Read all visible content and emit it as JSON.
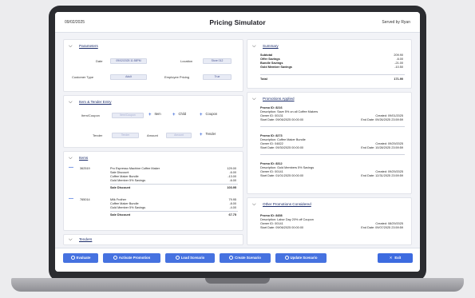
{
  "header": {
    "date": "09/02/2025",
    "title": "Pricing Simulator",
    "user": "Served by Ryan"
  },
  "parameters": {
    "title": "Parameters",
    "date_label": "Date",
    "date_value": "09/02/2025 11:58PM",
    "location_label": "Location",
    "location_value": "Store 012",
    "customer_type_label": "Customer Type",
    "customer_type_value": "Adult",
    "employee_pricing_label": "Employee Pricing",
    "employee_pricing_value": "True"
  },
  "items_tender": {
    "title": "Item & Tender Entry",
    "item_label": "Item/Coupon",
    "item_placeholder": "Item/Coupon",
    "add_item": "Item",
    "add_child": "Child",
    "add_coupon": "Coupon",
    "tender_label": "Tender",
    "tender_placeholder": "Tender",
    "amount_label": "Amount",
    "amount_placeholder": "Amount",
    "add_tender": "Tender"
  },
  "items": {
    "title": "Items",
    "groups": [
      {
        "code": "362519",
        "lines": [
          {
            "desc": "Pro Espresso Machine Coffee Maker",
            "value": "129.00"
          },
          {
            "desc": "Sale Discount",
            "value": "-6.00"
          },
          {
            "desc": "Coffee Maker Bundle",
            "value": "-13.00"
          },
          {
            "desc": "Gold Member 5% Savings",
            "value": "-6.00"
          }
        ],
        "total_label": "Sale Discount",
        "total_value": "103.95"
      },
      {
        "code": "765014",
        "lines": [
          {
            "desc": "Milk Frother",
            "value": "79.95"
          },
          {
            "desc": "Coffee Maker Bundle",
            "value": "-8.00"
          },
          {
            "desc": "Gold Member 5% Savings",
            "value": "-4.00"
          }
        ],
        "total_label": "Sale Discount",
        "total_value": "67.75"
      }
    ]
  },
  "tenders": {
    "title": "Tenders"
  },
  "summary": {
    "title": "Summary",
    "rows": [
      {
        "label": "Subtotal",
        "value": "209.90"
      },
      {
        "label": "Offer Savings",
        "value": "-6.00"
      },
      {
        "label": "Bundle Savings",
        "value": "-21.00"
      },
      {
        "label": "Gold Member Savings",
        "value": "-10.50"
      }
    ],
    "total_label": "Total",
    "total_value": "171.90"
  },
  "promotions_applied": {
    "title": "Promotions Applied",
    "promos": [
      {
        "id": "Promo ID: 8216",
        "desc": "Description: Save 5% on all Coffee Makers",
        "owner": "Owner ID: 00131",
        "start": "Start Date: 09/06/2025 00:00:00",
        "created": "Created: 09/01/2025",
        "end": "End Date: 09/26/2025 23:59:59"
      },
      {
        "id": "Promo ID: 8273",
        "desc": "Description: Coffee Maker Bundle",
        "owner": "Owner ID: 04822",
        "start": "Start Date: 09/30/2025 00:00:00",
        "created": "Created: 09/29/2025",
        "end": "End Date: 10/28/2025 23:59:59"
      },
      {
        "id": "Promo ID: 8312",
        "desc": "Description: Gold Members 5% Savings",
        "owner": "Owner ID: 00141",
        "start": "Start Date: 01/01/2025 00:00:00",
        "created": "Created: 09/29/2025",
        "end": "End Date: 12/31/2025 23:59:59"
      }
    ]
  },
  "other_promotions": {
    "title": "Other Promotions Considered",
    "promos": [
      {
        "id": "Promo ID: 8458",
        "desc": "Description: Labor Day 20% off Coupon",
        "owner": "Owner ID: 00141",
        "start": "Start Date: 09/06/2025 00:00:00",
        "created": "Created: 08/29/2025",
        "end": "End Date: 09/07/2025 23:59:59"
      }
    ]
  },
  "footer": {
    "evaluate": "Evaluate",
    "activate": "Activate Promotion",
    "load": "Load Scenario",
    "create": "Create Scenario",
    "update": "Update Scenario",
    "exit": "Exit"
  },
  "colors": {
    "accent": "#4672e0",
    "heading": "#1c2d6b"
  }
}
